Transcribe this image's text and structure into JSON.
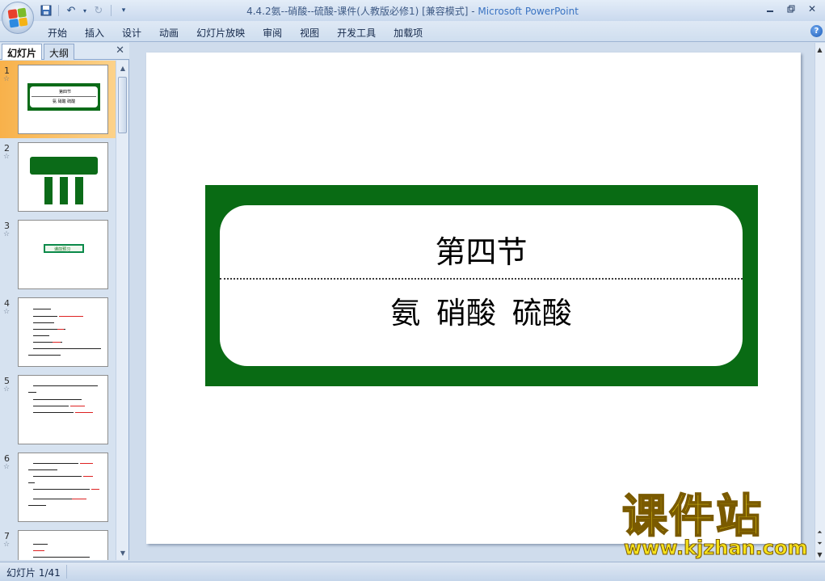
{
  "window": {
    "title_doc": "4.4.2氨--硝酸--硫酸-课件(人教版必修1) [兼容模式] - ",
    "title_app": "Microsoft PowerPoint"
  },
  "qat": {
    "items": [
      "save-icon",
      "undo-icon",
      "redo-icon",
      "customize-icon"
    ]
  },
  "ribbon": {
    "tabs": [
      "开始",
      "插入",
      "设计",
      "动画",
      "幻灯片放映",
      "审阅",
      "视图",
      "开发工具",
      "加载项"
    ]
  },
  "panel": {
    "tab_slides": "幻灯片",
    "tab_outline": "大纲",
    "thumbnails": [
      {
        "num": "1",
        "selected": true
      },
      {
        "num": "2",
        "selected": false
      },
      {
        "num": "3",
        "selected": false
      },
      {
        "num": "4",
        "selected": false
      },
      {
        "num": "5",
        "selected": false
      },
      {
        "num": "6",
        "selected": false
      },
      {
        "num": "7",
        "selected": false
      }
    ],
    "thumb1_line1": "第四节",
    "thumb1_line2": "氨 硝酸 硫酸",
    "thumb3_label": "课前预习"
  },
  "slide": {
    "title": "第四节",
    "subtitle": "氨 硝酸 硫酸"
  },
  "status": {
    "slide_counter": "幻灯片 1/41"
  },
  "watermark": {
    "brand": "课件站",
    "url": "www.kjzhan.com"
  },
  "colors": {
    "banner_green": "#096b14",
    "selected_thumb": "#f8b14a",
    "watermark_yellow": "#f6e11b"
  }
}
